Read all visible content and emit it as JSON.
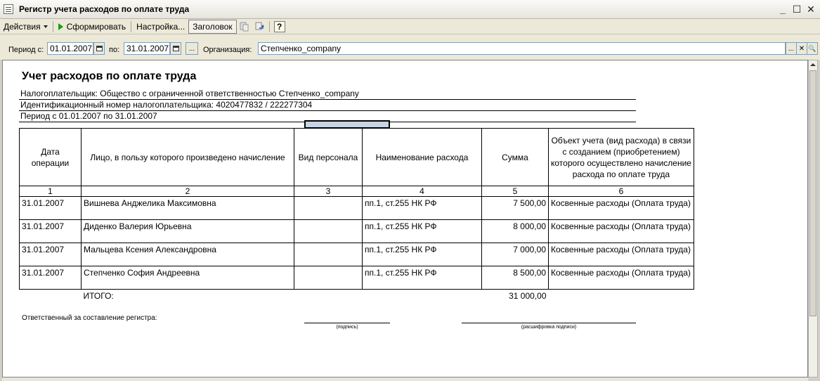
{
  "window": {
    "title": "Регистр учета расходов по оплате труда",
    "controls": [
      "_",
      "☐",
      "✕"
    ]
  },
  "toolbar": {
    "actions": "Действия",
    "generate": "Сформировать",
    "settings": "Настройка...",
    "header": "Заголовок",
    "help": "?"
  },
  "filters": {
    "period_from_label": "Период с:",
    "period_from": "01.01.2007",
    "period_to_label": "по:",
    "period_to": "31.01.2007",
    "more": "...",
    "org_label": "Организация:",
    "org": "Степченко_company",
    "btn_more": "...",
    "btn_clear": "✕",
    "btn_search": "🔍"
  },
  "report": {
    "title": "Учет расходов по оплате труда",
    "taxpayer": "Налогоплательщик: Общество с ограниченной ответственностью Степченко_company",
    "inn": "Идентификационный номер налогоплательщика: 4020477832 / 222277304",
    "period": "Период с 01.01.2007 по 31.01.2007",
    "columns": [
      "Дата операции",
      "Лицо, в пользу которого произведено начисление",
      "Вид персонала",
      "Наименование расхода",
      "Сумма",
      "Объект учета (вид расхода) в связи с созданием (приобретением) которого осуществлено начисление расхода по оплате труда"
    ],
    "column_numbers": [
      "1",
      "2",
      "3",
      "4",
      "5",
      "6"
    ],
    "rows": [
      {
        "date": "31.01.2007",
        "person": "Вишнева Анджелика Максимовна",
        "staff": "",
        "expense": "пп.1, ст.255 НК РФ",
        "amount": "7 500,00",
        "object": "Косвенные расходы (Оплата труда)"
      },
      {
        "date": "31.01.2007",
        "person": "Диденко Валерия Юрьевна",
        "staff": "",
        "expense": "пп.1, ст.255 НК РФ",
        "amount": "8 000,00",
        "object": "Косвенные расходы (Оплата труда)"
      },
      {
        "date": "31.01.2007",
        "person": "Мальцева Ксения Александровна",
        "staff": "",
        "expense": "пп.1, ст.255 НК РФ",
        "amount": "7 000,00",
        "object": "Косвенные расходы (Оплата труда)"
      },
      {
        "date": "31.01.2007",
        "person": "Степченко София Андреевна",
        "staff": "",
        "expense": "пп.1, ст.255 НК РФ",
        "amount": "8 500,00",
        "object": "Косвенные расходы (Оплата труда)"
      }
    ],
    "total_label": "ИТОГО:",
    "total_amount": "31 000,00",
    "responsible_label": "Ответственный за составление регистра:",
    "signature_caption": "(подпись)",
    "decode_caption": "(расшифровка подписи)"
  }
}
